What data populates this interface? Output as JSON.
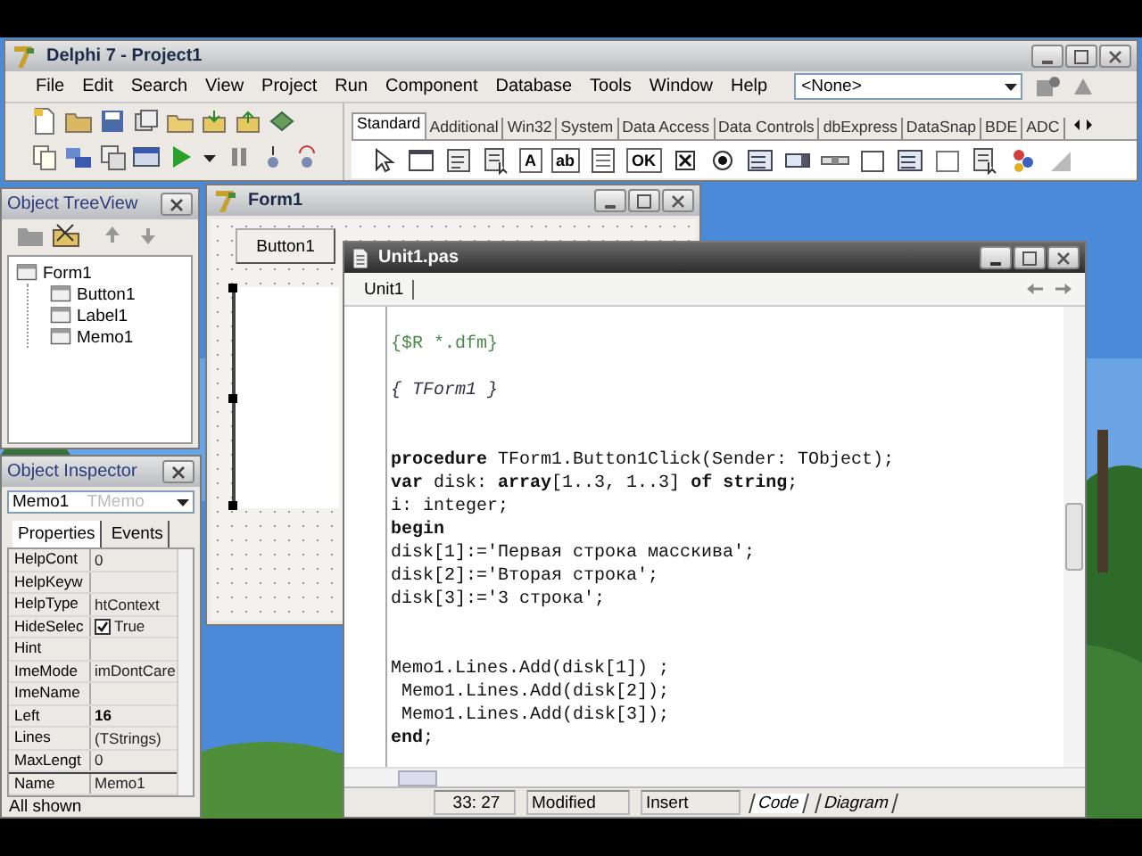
{
  "main_window": {
    "title": "Delphi 7 - Project1"
  },
  "menu": [
    "File",
    "Edit",
    "Search",
    "View",
    "Project",
    "Run",
    "Component",
    "Database",
    "Tools",
    "Window",
    "Help"
  ],
  "desktop_combo": {
    "value": "<None>"
  },
  "palette_tabs": [
    {
      "label": "Standard",
      "selected": true
    },
    {
      "label": "Additional",
      "selected": false
    },
    {
      "label": "Win32",
      "selected": false
    },
    {
      "label": "System",
      "selected": false
    },
    {
      "label": "Data Access",
      "selected": false
    },
    {
      "label": "Data Controls",
      "selected": false
    },
    {
      "label": "dbExpress",
      "selected": false
    },
    {
      "label": "DataSnap",
      "selected": false
    },
    {
      "label": "BDE",
      "selected": false
    },
    {
      "label": "ADC",
      "selected": false
    }
  ],
  "palette_icons": [
    {
      "kind": "pointer"
    },
    {
      "kind": "frame"
    },
    {
      "kind": "menu"
    },
    {
      "kind": "popup"
    },
    {
      "kind": "glyph",
      "glyph": "A"
    },
    {
      "kind": "glyph",
      "glyph": "ab"
    },
    {
      "kind": "memo"
    },
    {
      "kind": "glyph",
      "glyph": "OK"
    },
    {
      "kind": "check"
    },
    {
      "kind": "radio"
    },
    {
      "kind": "list"
    },
    {
      "kind": "combo"
    },
    {
      "kind": "scrollbar"
    },
    {
      "kind": "group"
    },
    {
      "kind": "list"
    },
    {
      "kind": "panel"
    },
    {
      "kind": "popup"
    },
    {
      "kind": "action"
    },
    {
      "kind": "corner"
    }
  ],
  "tree_view": {
    "title": "Object TreeView",
    "root": {
      "label": "Form1",
      "children": [
        {
          "label": "Button1"
        },
        {
          "label": "Label1"
        },
        {
          "label": "Memo1"
        }
      ]
    }
  },
  "object_inspector": {
    "title": "Object Inspector",
    "object": "Memo1",
    "type": "TMemo",
    "tabs": [
      {
        "label": "Properties",
        "selected": true
      },
      {
        "label": "Events",
        "selected": false
      }
    ],
    "rows": [
      {
        "name": "HelpCont",
        "value": "0",
        "kind": "text",
        "modified": false,
        "selected": false
      },
      {
        "name": "HelpKeyw",
        "kind": "text",
        "selected": false
      },
      {
        "name": "HelpType",
        "value": "htContext",
        "kind": "text",
        "modified": false,
        "selected": false
      },
      {
        "name": "HideSelec",
        "value": "True",
        "kind": "check",
        "checked": true,
        "modified": false,
        "selected": false
      },
      {
        "name": "Hint",
        "kind": "text",
        "selected": false
      },
      {
        "name": "ImeMode",
        "value": "imDontCare",
        "kind": "text",
        "modified": false,
        "selected": false
      },
      {
        "name": "ImeName",
        "kind": "text",
        "selected": false
      },
      {
        "name": "Left",
        "value": "16",
        "kind": "text",
        "modified": true,
        "selected": false
      },
      {
        "name": "Lines",
        "value": "(TStrings)",
        "kind": "text",
        "modified": false,
        "selected": false
      },
      {
        "name": "MaxLengt",
        "value": "0",
        "kind": "text",
        "modified": false,
        "selected": false
      },
      {
        "name": "Name",
        "value": "Memo1",
        "kind": "text",
        "modified": false,
        "selected": true
      }
    ],
    "status": "All shown"
  },
  "form_window": {
    "title": "Form1",
    "button": "Button1"
  },
  "editor": {
    "title": "Unit1.pas",
    "tabs": [
      {
        "label": "Unit1",
        "selected": true
      }
    ],
    "lines": [
      {
        "kind": "blank"
      },
      {
        "kind": "directive",
        "text": "{$R *.dfm}"
      },
      {
        "kind": "blank"
      },
      {
        "kind": "comment",
        "text": "{ TForm1 }"
      },
      {
        "kind": "blank"
      },
      {
        "kind": "blank"
      },
      {
        "kind": "code",
        "text": "**procedure** TForm1.Button1Click(Sender: TObject);"
      },
      {
        "kind": "code",
        "text": "**var** disk: **array**[1..3, 1..3] **of** **string**;"
      },
      {
        "kind": "code",
        "text": "i: integer;"
      },
      {
        "kind": "code",
        "text": "**begin**"
      },
      {
        "kind": "code",
        "text": "disk[1]:='Первая строка масскива';"
      },
      {
        "kind": "code",
        "text": "disk[2]:='Вторая строка';"
      },
      {
        "kind": "code",
        "text": "disk[3]:='3 строка';"
      },
      {
        "kind": "blank"
      },
      {
        "kind": "blank"
      },
      {
        "kind": "code",
        "text": "Memo1.Lines.Add(disk[1]) ;"
      },
      {
        "kind": "code",
        "text": " Memo1.Lines.Add(disk[2]);"
      },
      {
        "kind": "code",
        "text": " Memo1.Lines.Add(disk[3]);"
      },
      {
        "kind": "code",
        "text": "**end**;"
      }
    ],
    "status": {
      "position": "33: 27",
      "state": "Modified",
      "mode": "Insert"
    },
    "view_tabs": [
      {
        "label": "Code",
        "selected": true
      },
      {
        "label": "Diagram",
        "selected": false
      }
    ]
  }
}
